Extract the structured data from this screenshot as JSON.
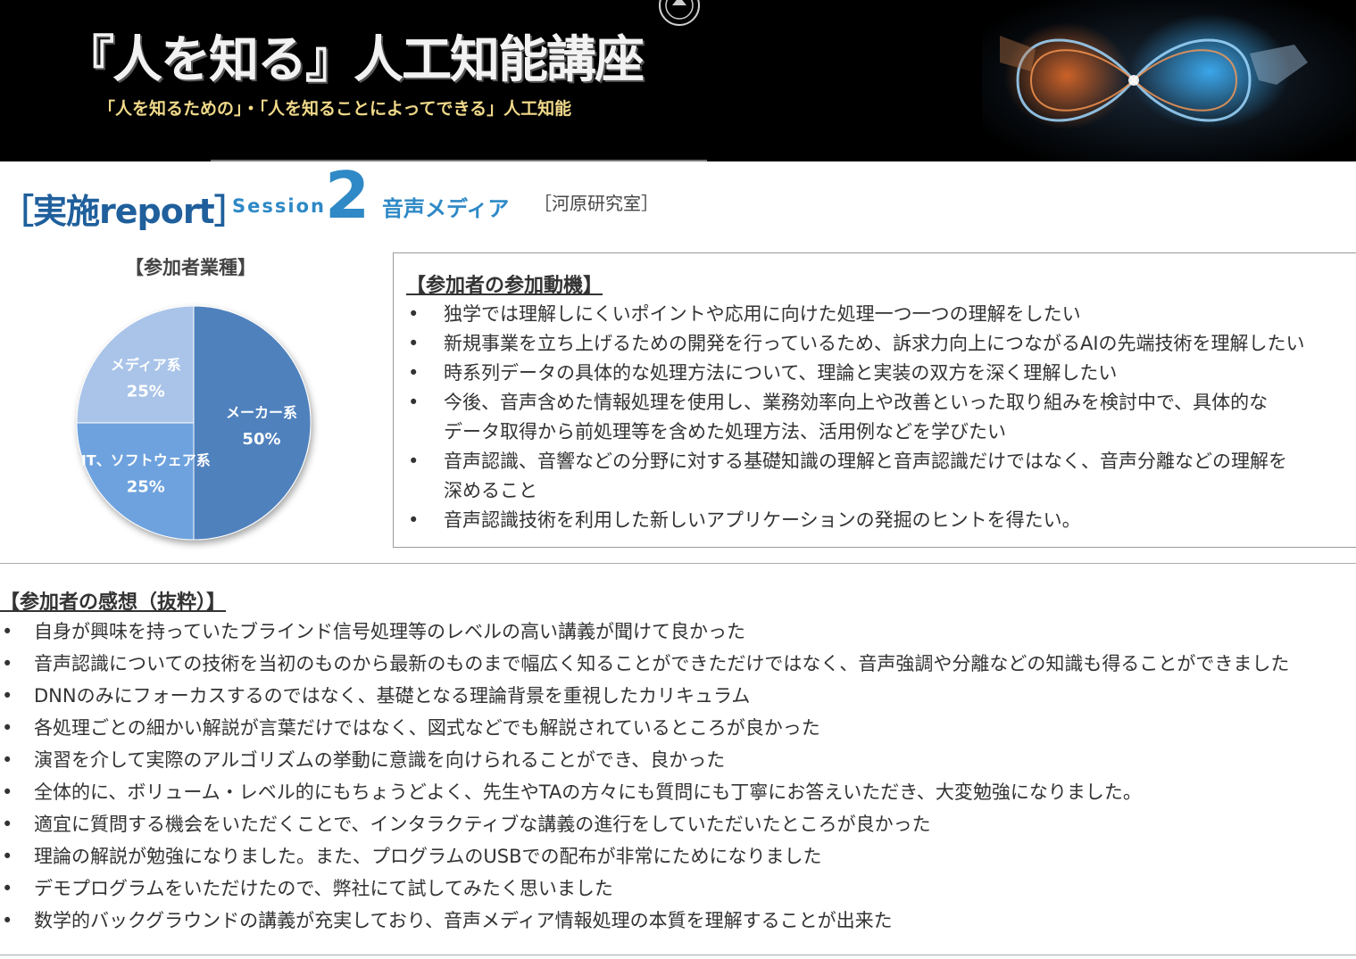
{
  "banner": {
    "title": "『人を知る』人工知能講座",
    "subtitle": "「人を知るための」・「人を知ることによってできる」人工知能"
  },
  "session": {
    "report_label": "［実施report］",
    "session_word": "Session",
    "session_number": "2",
    "topic": "音声メディア",
    "lab": "［河原研究室］"
  },
  "chart_data": {
    "type": "pie",
    "title": "【参加者業種】",
    "slices": [
      {
        "label": "メーカー系",
        "value": 50,
        "value_label": "50%",
        "color": "#4f81bd"
      },
      {
        "label": "IT、ソフトウェア系",
        "value": 25,
        "value_label": "25%",
        "color": "#6ea2de"
      },
      {
        "label": "メディア系",
        "value": 25,
        "value_label": "25%",
        "color": "#a9c4e8"
      }
    ]
  },
  "motives": {
    "title": "【参加者の参加動機】",
    "bullet": "•",
    "items": [
      [
        "独学では理解しにくいポイントや応用に向けた処理一つ一つの理解をしたい"
      ],
      [
        "新規事業を立ち上げるための開発を行っているため、訴求力向上につながるAIの先端技術を理解したい"
      ],
      [
        "時系列データの具体的な処理方法について、理論と実装の双方を深く理解したい"
      ],
      [
        "今後、音声含めた情報処理を使用し、業務効率向上や改善といった取り組みを検討中で、具体的な",
        "データ取得から前処理等を含めた処理方法、活用例などを学びたい"
      ],
      [
        "音声認識、音響などの分野に対する基礎知識の理解と音声認識だけではなく、音声分離などの理解を",
        "深めること"
      ],
      [
        "音声認識技術を利用した新しいアプリケーションの発掘のヒントを得たい。"
      ]
    ]
  },
  "impressions": {
    "title": "【参加者の感想（抜粋）】",
    "bullet": "•",
    "items": [
      "自身が興味を持っていたブラインド信号処理等のレベルの高い講義が聞けて良かった",
      "音声認識についての技術を当初のものから最新のものまで幅広く知ることができただけではなく、音声強調や分離などの知識も得ることができました",
      "DNNのみにフォーカスするのではなく、基礎となる理論背景を重視したカリキュラム",
      "各処理ごとの細かい解説が言葉だけではなく、図式などでも解説されているところが良かった",
      "演習を介して実際のアルゴリズムの挙動に意識を向けられることができ、良かった",
      "全体的に、ボリューム・レベル的にもちょうどよく、先生やTAの方々にも質問にも丁寧にお答えいただき、大変勉強になりました。",
      "適宜に質問する機会をいただくことで、インタラクティブな講義の進行をしていただいたところが良かった",
      "理論の解説が勉強になりました。また、プログラムのUSBでの配布が非常にためになりました",
      "デモプログラムをいただけたので、弊社にて試してみたく思いました",
      "数学的バックグラウンドの講義が充実しており、音声メディア情報処理の本質を理解することが出来た"
    ]
  }
}
